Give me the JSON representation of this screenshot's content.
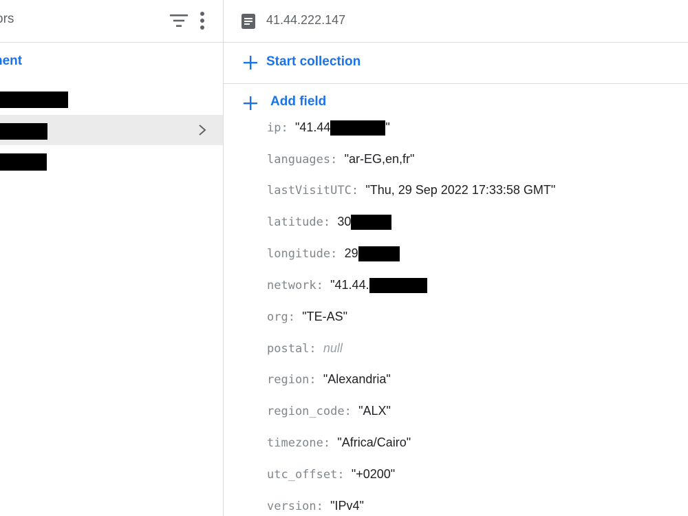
{
  "left_panel": {
    "title": "ors",
    "add_label": "nent"
  },
  "doc": {
    "title": "41.44.222.147",
    "start_collection_label": "Start collection",
    "add_field_label": "Add field"
  },
  "fields": [
    {
      "key": "ip",
      "value": "\"41.44",
      "suffix": "\""
    },
    {
      "key": "languages",
      "value": "\"ar-EG,en,fr\"",
      "suffix": ""
    },
    {
      "key": "lastVisitUTC",
      "value": "\"Thu, 29 Sep 2022 17:33:58 GMT\"",
      "suffix": ""
    },
    {
      "key": "latitude",
      "value": "30",
      "suffix": ""
    },
    {
      "key": "longitude",
      "value": "29",
      "suffix": ""
    },
    {
      "key": "network",
      "value": "\"41.44.",
      "suffix": ""
    },
    {
      "key": "org",
      "value": "\"TE-AS\"",
      "suffix": ""
    },
    {
      "key": "postal",
      "value": "null",
      "suffix": ""
    },
    {
      "key": "region",
      "value": "\"Alexandria\"",
      "suffix": ""
    },
    {
      "key": "region_code",
      "value": "\"ALX\"",
      "suffix": ""
    },
    {
      "key": "timezone",
      "value": "\"Africa/Cairo\"",
      "suffix": ""
    },
    {
      "key": "utc_offset",
      "value": "\"+0200\"",
      "suffix": ""
    },
    {
      "key": "version",
      "value": "\"IPv4\"",
      "suffix": ""
    }
  ],
  "colors": {
    "accent": "#1a73e8",
    "key": "#80868b",
    "selected_row": "#ebebeb"
  }
}
